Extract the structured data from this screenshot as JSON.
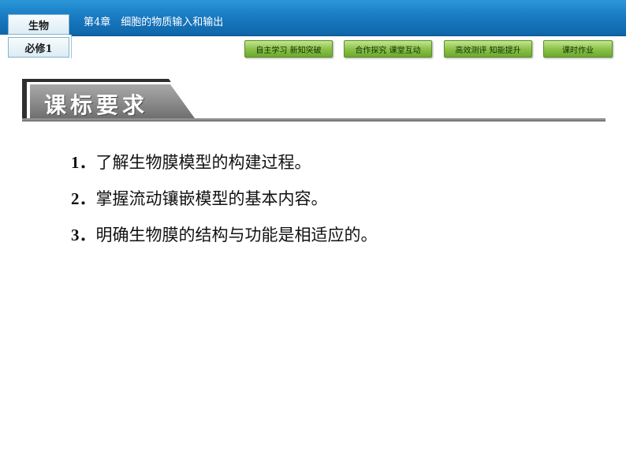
{
  "header": {
    "subject": "生物",
    "volume": "必修1",
    "chapter": "第4章　细胞的物质输入和输出"
  },
  "nav": {
    "items": [
      {
        "label": "自主学习  新知突破"
      },
      {
        "label": "合作探究  课堂互动"
      },
      {
        "label": "高效测评  知能提升"
      },
      {
        "label": "课时作业"
      }
    ]
  },
  "section": {
    "title": "课标要求"
  },
  "objectives": [
    {
      "num": "1．",
      "text": "了解生物膜模型的构建过程。"
    },
    {
      "num": "2．",
      "text": "掌握流动镶嵌模型的基本内容。"
    },
    {
      "num": "3．",
      "text": "明确生物膜的结构与功能是相适应的。"
    }
  ],
  "colors": {
    "header_blue": "#1777bf",
    "nav_green": "#8cc24a",
    "heading_gray": "#8a8a8a"
  }
}
